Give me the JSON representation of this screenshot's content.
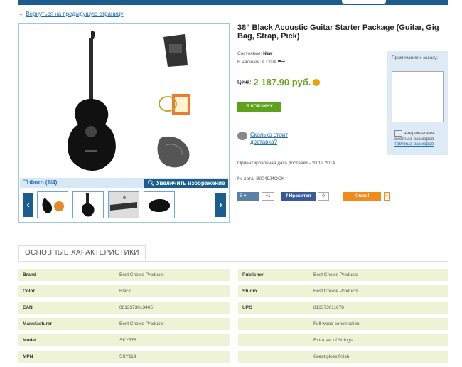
{
  "back_link": "Вернуться на предыдущую страницу",
  "gallery": {
    "photo_counter": "Фото (1/4)",
    "zoom_label": "Увеличить изображение",
    "prev_arrow": "‹",
    "next_arrow": "›"
  },
  "product": {
    "title": "38\" Black Acoustic Guitar Starter Package (Guitar, Gig Bag, Strap, Pick)",
    "condition_label": "Состояние:",
    "condition_value": "New",
    "stock_label": "В наличии:",
    "stock_value": "в США",
    "price_label": "Цена:",
    "price_value": "2 187.90 руб.",
    "cart_button": "В КОРЗИНУ",
    "shipping_link": "Сколько стоит доставка?",
    "est_delivery": "Ориентировочная дата доставки - 20.12.2014",
    "lot_label": "№ лота:",
    "lot_value": "B0049J4OOK"
  },
  "social": {
    "vk_label": "В",
    "vk_count": "+1",
    "fb_label": "Нравится",
    "fb_count": "0",
    "ok_label": "Класс!",
    "ok_count": "0"
  },
  "notes": {
    "label": "Примечания к заказу:",
    "value": ""
  },
  "sizes": {
    "text": "американская система размеров",
    "link": "таблица размеров"
  },
  "section_title": "ОСНОВНЫЕ ХАРАКТЕРИСТИКИ",
  "specs_left": [
    {
      "k": "Brand",
      "v": "Best Choice Products"
    },
    {
      "k": "Color",
      "v": "Black"
    },
    {
      "k": "EAN",
      "v": "0813373013405"
    },
    {
      "k": "Manufacturer",
      "v": "Best Choice Products"
    },
    {
      "k": "Model",
      "v": "SKY676"
    },
    {
      "k": "MPN",
      "v": "SKY119"
    }
  ],
  "specs_right": [
    {
      "k": "Publisher",
      "v": "Best Choice Products"
    },
    {
      "k": "Studio",
      "v": "Best Choice Products"
    },
    {
      "k": "UPC",
      "v": "813373011678"
    },
    {
      "k": "",
      "v": "Full wood construction"
    },
    {
      "k": "",
      "v": "Extra set of Strings"
    },
    {
      "k": "",
      "v": "Great gloss finish"
    }
  ],
  "colors": {
    "brand_blue": "#1c5d8e",
    "price_green": "#6aa61a",
    "cart_green": "#5da11c",
    "spec_row_bg": "#eef3d6"
  }
}
